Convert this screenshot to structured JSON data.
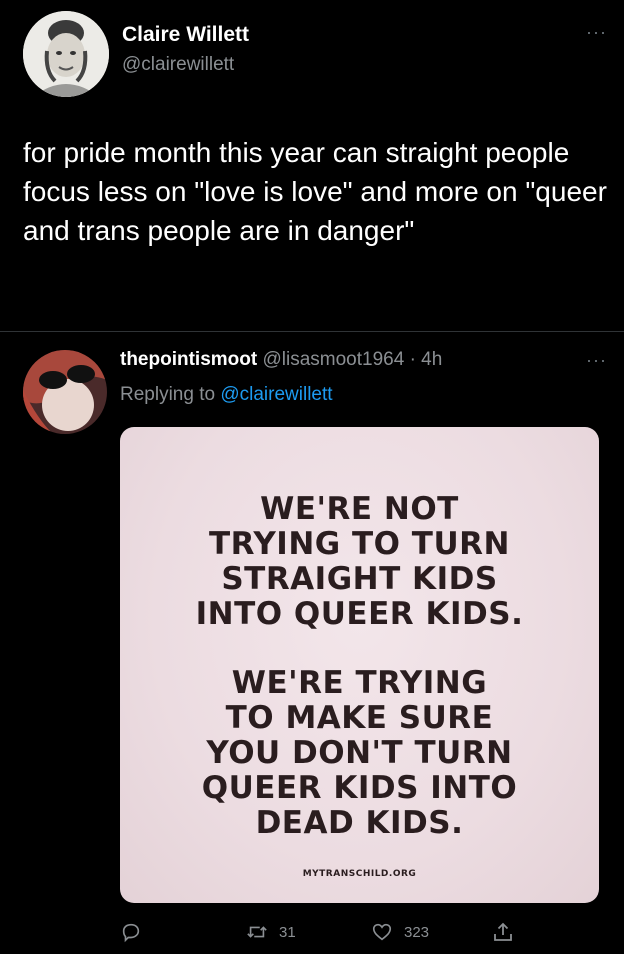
{
  "tweet": {
    "author_name": "Claire Willett",
    "author_handle": "@clairewillett",
    "text": "for pride month this year can straight people focus less on \"love is love\" and more on \"queer and trans people are in danger\""
  },
  "reply": {
    "author_name": "thepointismoot",
    "author_handle": "@lisasmoot1964",
    "time": "· 4h",
    "replying_prefix": "Replying to",
    "replying_handle": "@clairewillett",
    "poster": {
      "lines_a": [
        "WE'RE NOT",
        "TRYING TO TURN",
        "STRAIGHT KIDS",
        "INTO QUEER KIDS."
      ],
      "lines_b": [
        "WE'RE TRYING",
        "TO MAKE SURE",
        "YOU DON'T TURN",
        "QUEER KIDS INTO",
        "DEAD KIDS."
      ],
      "site": "MYTRANSCHILD.ORG"
    },
    "actions": {
      "retweets": "31",
      "likes": "323"
    }
  },
  "icons": {
    "more": "more-icon",
    "reply": "reply-icon",
    "retweet": "retweet-icon",
    "like": "heart-icon",
    "share": "share-icon"
  }
}
